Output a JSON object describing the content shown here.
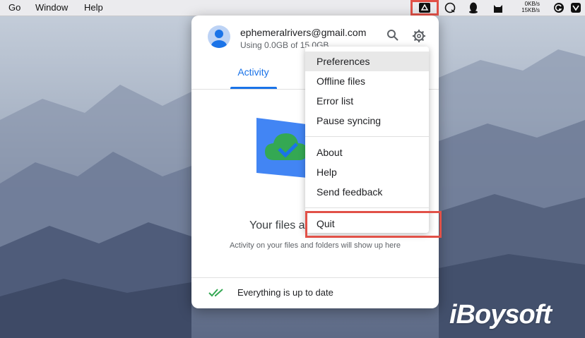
{
  "menubar": {
    "items": [
      "Go",
      "Window",
      "Help"
    ],
    "net_up": "0KB/s",
    "net_down": "15KB/s"
  },
  "account": {
    "email": "ephemeralrivers@gmail.com",
    "usage": "Using 0.0GB of 15.0GB"
  },
  "tabs": [
    {
      "label": "Activity",
      "active": true
    }
  ],
  "empty_state": {
    "title": "Your files a",
    "subtitle": "Activity on your files and folders will show up here"
  },
  "footer": {
    "status": "Everything is up to date"
  },
  "settings_menu": {
    "groups": [
      [
        "Preferences",
        "Offline files",
        "Error list",
        "Pause syncing"
      ],
      [
        "About",
        "Help",
        "Send feedback"
      ],
      [
        "Quit"
      ]
    ],
    "hovered": "Preferences"
  },
  "icons": [
    "search-icon",
    "gear-icon",
    "drive-tray-icon",
    "checkmark-icon",
    "cloud-check-icon"
  ],
  "colors": {
    "accent": "#1a73e8",
    "highlight": "#e15148",
    "check": "#34a853"
  },
  "watermark": "iBoysoft"
}
